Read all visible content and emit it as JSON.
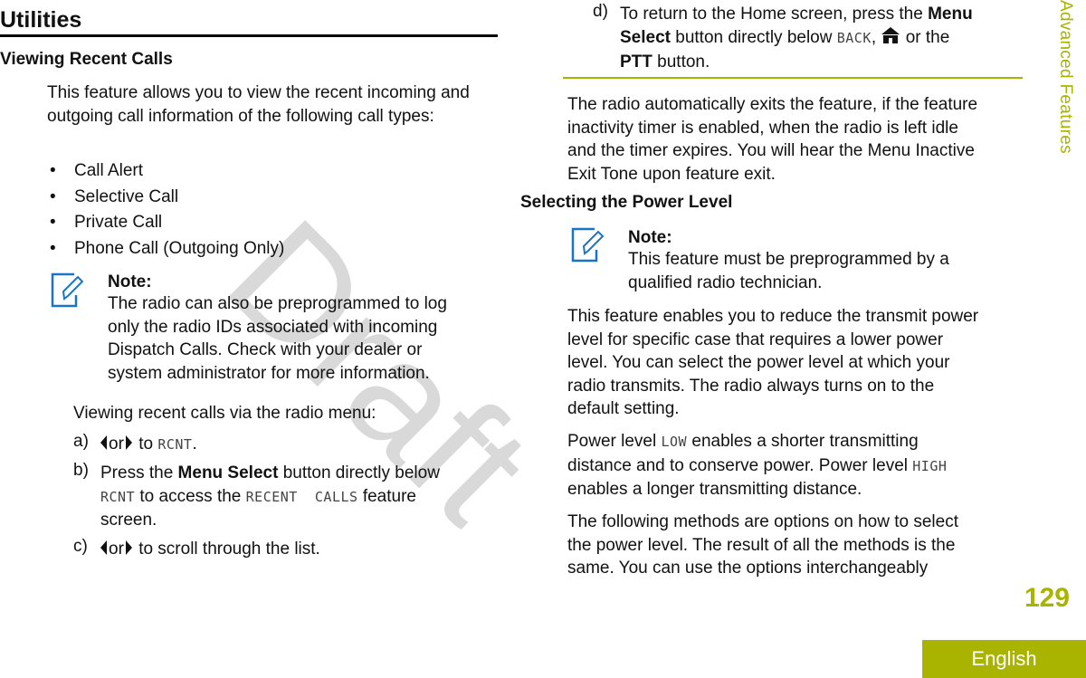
{
  "watermark": "Draft",
  "side_label": "Advanced Features",
  "page_number": "129",
  "language_tab": "English",
  "left": {
    "section_title": "Utilities",
    "subsection_title": "Viewing Recent Calls",
    "intro": "This feature allows you to view the recent incoming and outgoing call information of the following call types:",
    "call_types": [
      "Call Alert",
      "Selective Call",
      "Private Call",
      "Phone Call (Outgoing Only)"
    ],
    "note": {
      "title": "Note:",
      "lines": [
        "The radio can also be preprogrammed to log",
        "only the radio IDs associated with incoming",
        "Dispatch Calls. Check with your dealer or",
        "system administrator for more information."
      ]
    },
    "procedure_intro": "Viewing recent calls via the radio menu:",
    "steps": {
      "a": {
        "label": "a)",
        "or": "or",
        "to": "to",
        "display": "RCNT",
        "end": "."
      },
      "b": {
        "label": "b)",
        "pre": "Press the ",
        "bold": "Menu Select",
        "mid": " button directly below",
        "display1": "RCNT",
        "mid2": " to access the ",
        "display2": "RECENT  CALLS",
        "post": " feature",
        "line3": "screen."
      },
      "c": {
        "label": "c)",
        "or": "or",
        "post": "to scroll through the list."
      }
    }
  },
  "right": {
    "step_d": {
      "label": "d)",
      "pre": "To return to the Home screen, press the ",
      "bold1": "Menu",
      "bold2": "Select",
      "mid": " button directly below ",
      "display": "BACK",
      "mid2": ", ",
      "post": " or the",
      "bold3": "PTT",
      "end": " button."
    },
    "timeout_lines": [
      "The radio automatically exits the feature, if the feature",
      "inactivity timer is enabled, when the radio is left idle",
      "and the timer expires. You will hear the Menu Inactive",
      "Exit Tone upon feature exit."
    ],
    "subsection_title": "Selecting the Power Level",
    "note": {
      "title": "Note:",
      "lines": [
        "This feature must be preprogrammed by a",
        "qualified radio technician."
      ]
    },
    "desc_lines": [
      "This feature enables you to reduce the transmit power",
      "level for specific case that requires a lower power",
      "level. You can select the power level at which your",
      "radio transmits. The radio always turns on to the",
      "default setting."
    ],
    "power": {
      "pre": "Power level ",
      "low": "LOW",
      "mid": " enables a shorter transmitting",
      "line2": "distance and to conserve power. Power level ",
      "high": "HIGH",
      "line3": "enables a longer transmitting distance."
    },
    "methods_lines": [
      "The following methods are options on how to select",
      "the power level. The result of all the methods is the",
      "same. You can use the options interchangeably"
    ]
  },
  "colors": {
    "accent": "#a8b400",
    "note_icon": "#1a73c8"
  }
}
